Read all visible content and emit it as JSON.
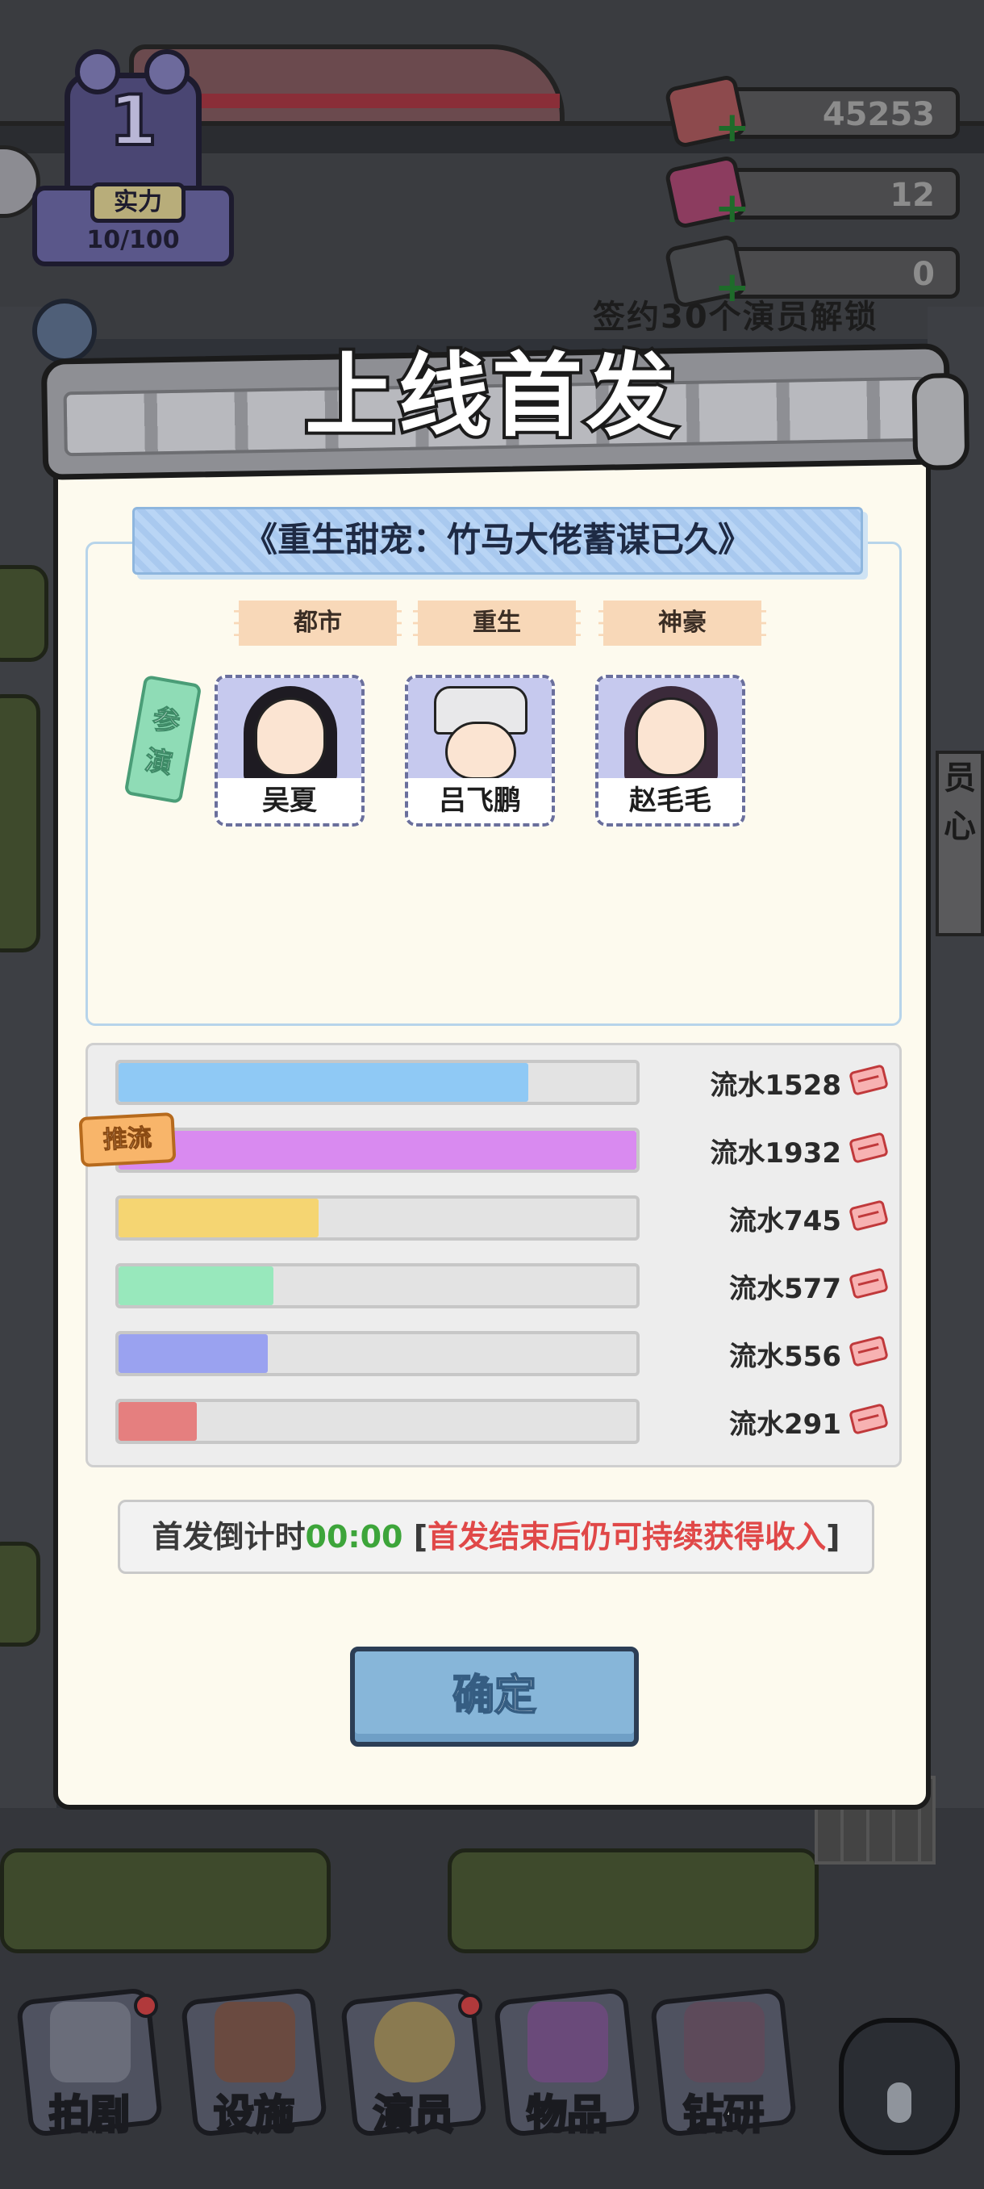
{
  "hud": {
    "level": "1",
    "strength_label": "实力",
    "strength_progress": "10/100",
    "currencies": [
      {
        "icon": "cash-stack-icon",
        "value": "45253"
      },
      {
        "icon": "pink-gem-icon",
        "value": "12"
      },
      {
        "icon": "ticket-card-icon",
        "value": "0"
      }
    ],
    "unlock_hint": "签约30个演员解锁"
  },
  "modal": {
    "title": "上线首发",
    "drama_title": "《重生甜宠：竹马大佬蓄谋已久》",
    "tags": [
      "都市",
      "重生",
      "神豪"
    ],
    "cast_label": "参演",
    "actors": [
      {
        "name": "吴夏"
      },
      {
        "name": "吕飞鹏"
      },
      {
        "name": "赵毛毛"
      }
    ],
    "promo_badge": "推流",
    "revenue_rows": [
      {
        "label": "流水1528",
        "value": 1528,
        "color": "#8fc9f5"
      },
      {
        "label": "流水1932",
        "value": 1932,
        "color": "#d98af0"
      },
      {
        "label": "流水745",
        "value": 745,
        "color": "#f5d572"
      },
      {
        "label": "流水577",
        "value": 577,
        "color": "#98e8bc"
      },
      {
        "label": "流水556",
        "value": 556,
        "color": "#9aa2f0"
      },
      {
        "label": "流水291",
        "value": 291,
        "color": "#e57f7f"
      }
    ],
    "revenue_max": 1932,
    "countdown": {
      "label": "首发倒计时",
      "time": "00:00",
      "note_open": "[",
      "note": "首发结束后仍可持续获得收入",
      "note_close": "]"
    },
    "confirm_label": "确定"
  },
  "bottom_nav": [
    {
      "label": "拍剧",
      "icon": "clapperboard-icon",
      "badge": true
    },
    {
      "label": "设施",
      "icon": "facility-icon",
      "badge": false
    },
    {
      "label": "演员",
      "icon": "actor-icon",
      "badge": true
    },
    {
      "label": "物品",
      "icon": "gem-bag-icon",
      "badge": false
    },
    {
      "label": "钻研",
      "icon": "research-icon",
      "badge": false
    },
    {
      "label": "",
      "icon": "lock-icon",
      "badge": false
    }
  ]
}
